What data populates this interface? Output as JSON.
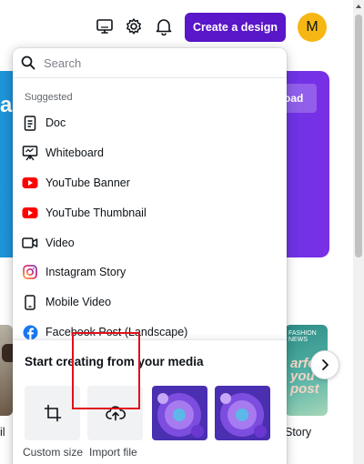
{
  "topbar": {
    "icons": [
      "desktop-icon",
      "settings-gear-icon",
      "notifications-bell-icon"
    ],
    "create_button": "Create a design",
    "avatar_initial": "M",
    "brand_color": "#5a16c9",
    "avatar_color": "#f6b714"
  },
  "background": {
    "hero_partial_text": "a",
    "hero_button_partial": "oad",
    "left_label_partial": "il",
    "right_label_partial": "Story",
    "right_thumb_text": "arfect you post",
    "right_thumb_small": "FASHION NEWS"
  },
  "search": {
    "placeholder": "Search"
  },
  "suggested": {
    "label": "Suggested",
    "items": [
      {
        "label": "Doc",
        "icon": "doc-icon"
      },
      {
        "label": "Whiteboard",
        "icon": "whiteboard-icon"
      },
      {
        "label": "YouTube Banner",
        "icon": "youtube-icon"
      },
      {
        "label": "YouTube Thumbnail",
        "icon": "youtube-icon"
      },
      {
        "label": "Video",
        "icon": "video-camera-icon"
      },
      {
        "label": "Instagram Story",
        "icon": "instagram-icon"
      },
      {
        "label": "Mobile Video",
        "icon": "mobile-phone-icon"
      },
      {
        "label": "Facebook Post (Landscape)",
        "icon": "facebook-icon"
      }
    ]
  },
  "media": {
    "title": "Start creating from your media",
    "custom_size": "Custom size",
    "import_file": "Import file",
    "highlight_color": "#e0101a"
  }
}
